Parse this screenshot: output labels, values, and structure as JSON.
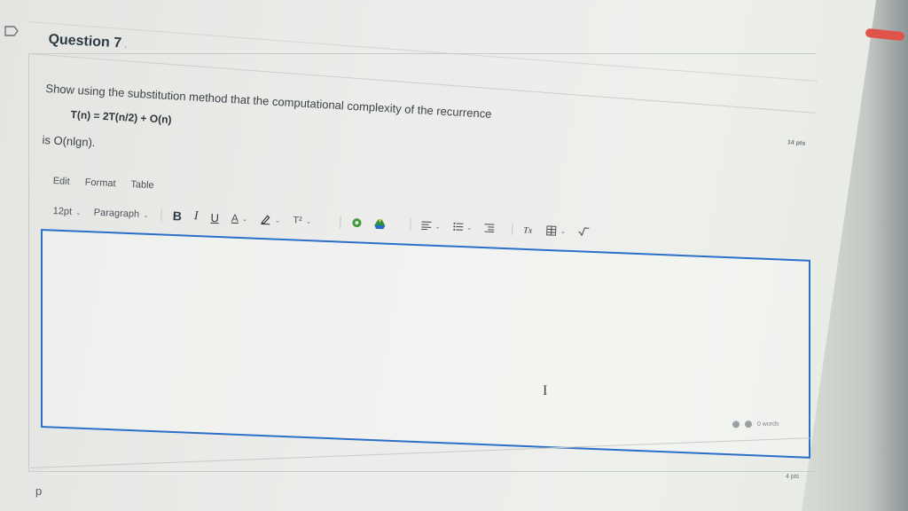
{
  "question": {
    "title": "Question 7",
    "title_marker": ".",
    "points_top": "",
    "points_mid": "14 pts",
    "points_bottom": "4 pts",
    "prompt": "Show using the substitution method that the computational complexity of the recurrence",
    "formula": "T(n) = 2T(n/2) + O(n)",
    "complexity": "is O(nlgn)."
  },
  "editor": {
    "menu": [
      "Edit",
      "Format",
      "Table"
    ],
    "font_size": "12pt",
    "block_format": "Paragraph",
    "bold": "B",
    "italic": "I",
    "underline": "U",
    "text_color": "A",
    "superscript": "T²",
    "word_count": "0 words",
    "caret": "I"
  },
  "footer": {
    "marker": "p"
  },
  "colors": {
    "accent": "#2b6fc9",
    "status": "#e0534a"
  }
}
